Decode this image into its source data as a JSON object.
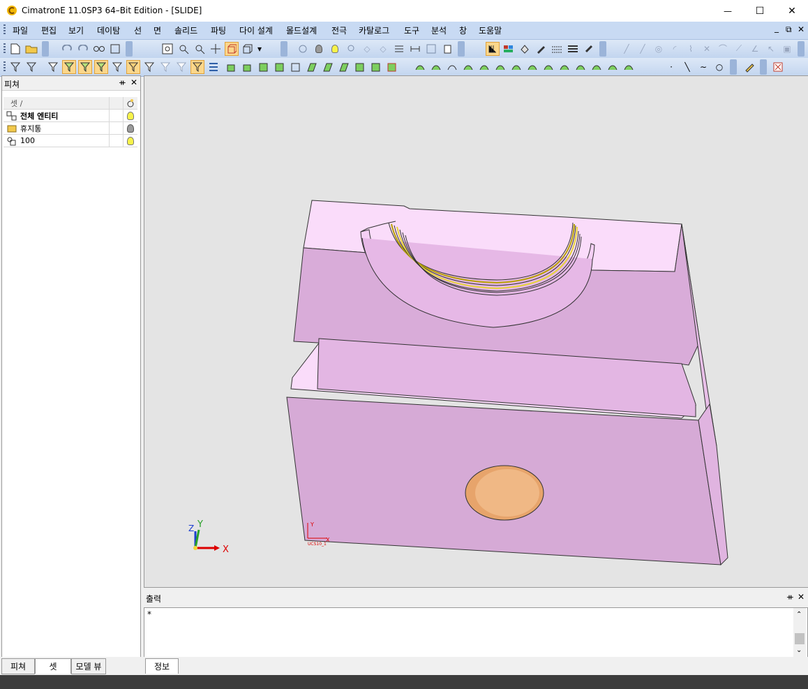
{
  "window": {
    "title": "CimatronE 11.0SP3 64–Bit Edition - [SLIDE]",
    "controls": {
      "minimize": "—",
      "maximize": "☐",
      "close": "✕"
    }
  },
  "menu": {
    "items": [
      "파일",
      "편집",
      "보기",
      "데이탐",
      "선",
      "면",
      "솔리드",
      "파팅",
      "다이 설계",
      "몰드설계",
      "전극",
      "카탈로그",
      "도구",
      "분석",
      "창",
      "도움말"
    ],
    "mdi_controls": [
      "_",
      "⧉",
      "✕"
    ]
  },
  "left_panel": {
    "title": "피쳐",
    "pin": "ᚑ",
    "close": "✕",
    "column_header": "셋 /",
    "rows": [
      {
        "label": "전체 엔티티",
        "bold": true,
        "bulb": "on"
      },
      {
        "label": "휴지통",
        "bold": false,
        "bulb": "off"
      },
      {
        "label": "100",
        "bold": false,
        "bulb": "on"
      }
    ],
    "tabs": [
      "피쳐",
      "셋",
      "모델 뷰"
    ],
    "selected_tab": "셋"
  },
  "viewport": {
    "background": "#e4e4e4",
    "part_color": "#f3d2f3",
    "hole_color": "#e7a46b",
    "triad": {
      "x": "X",
      "y": "Y",
      "z": "Z"
    },
    "ucs_label": "UCS10_1",
    "ucs_axes": {
      "x": "X",
      "y": "Y"
    }
  },
  "output_panel": {
    "title": "출력",
    "pin": "ᚑ",
    "close": "✕",
    "content": "*",
    "tabs": [
      "정보"
    ]
  }
}
